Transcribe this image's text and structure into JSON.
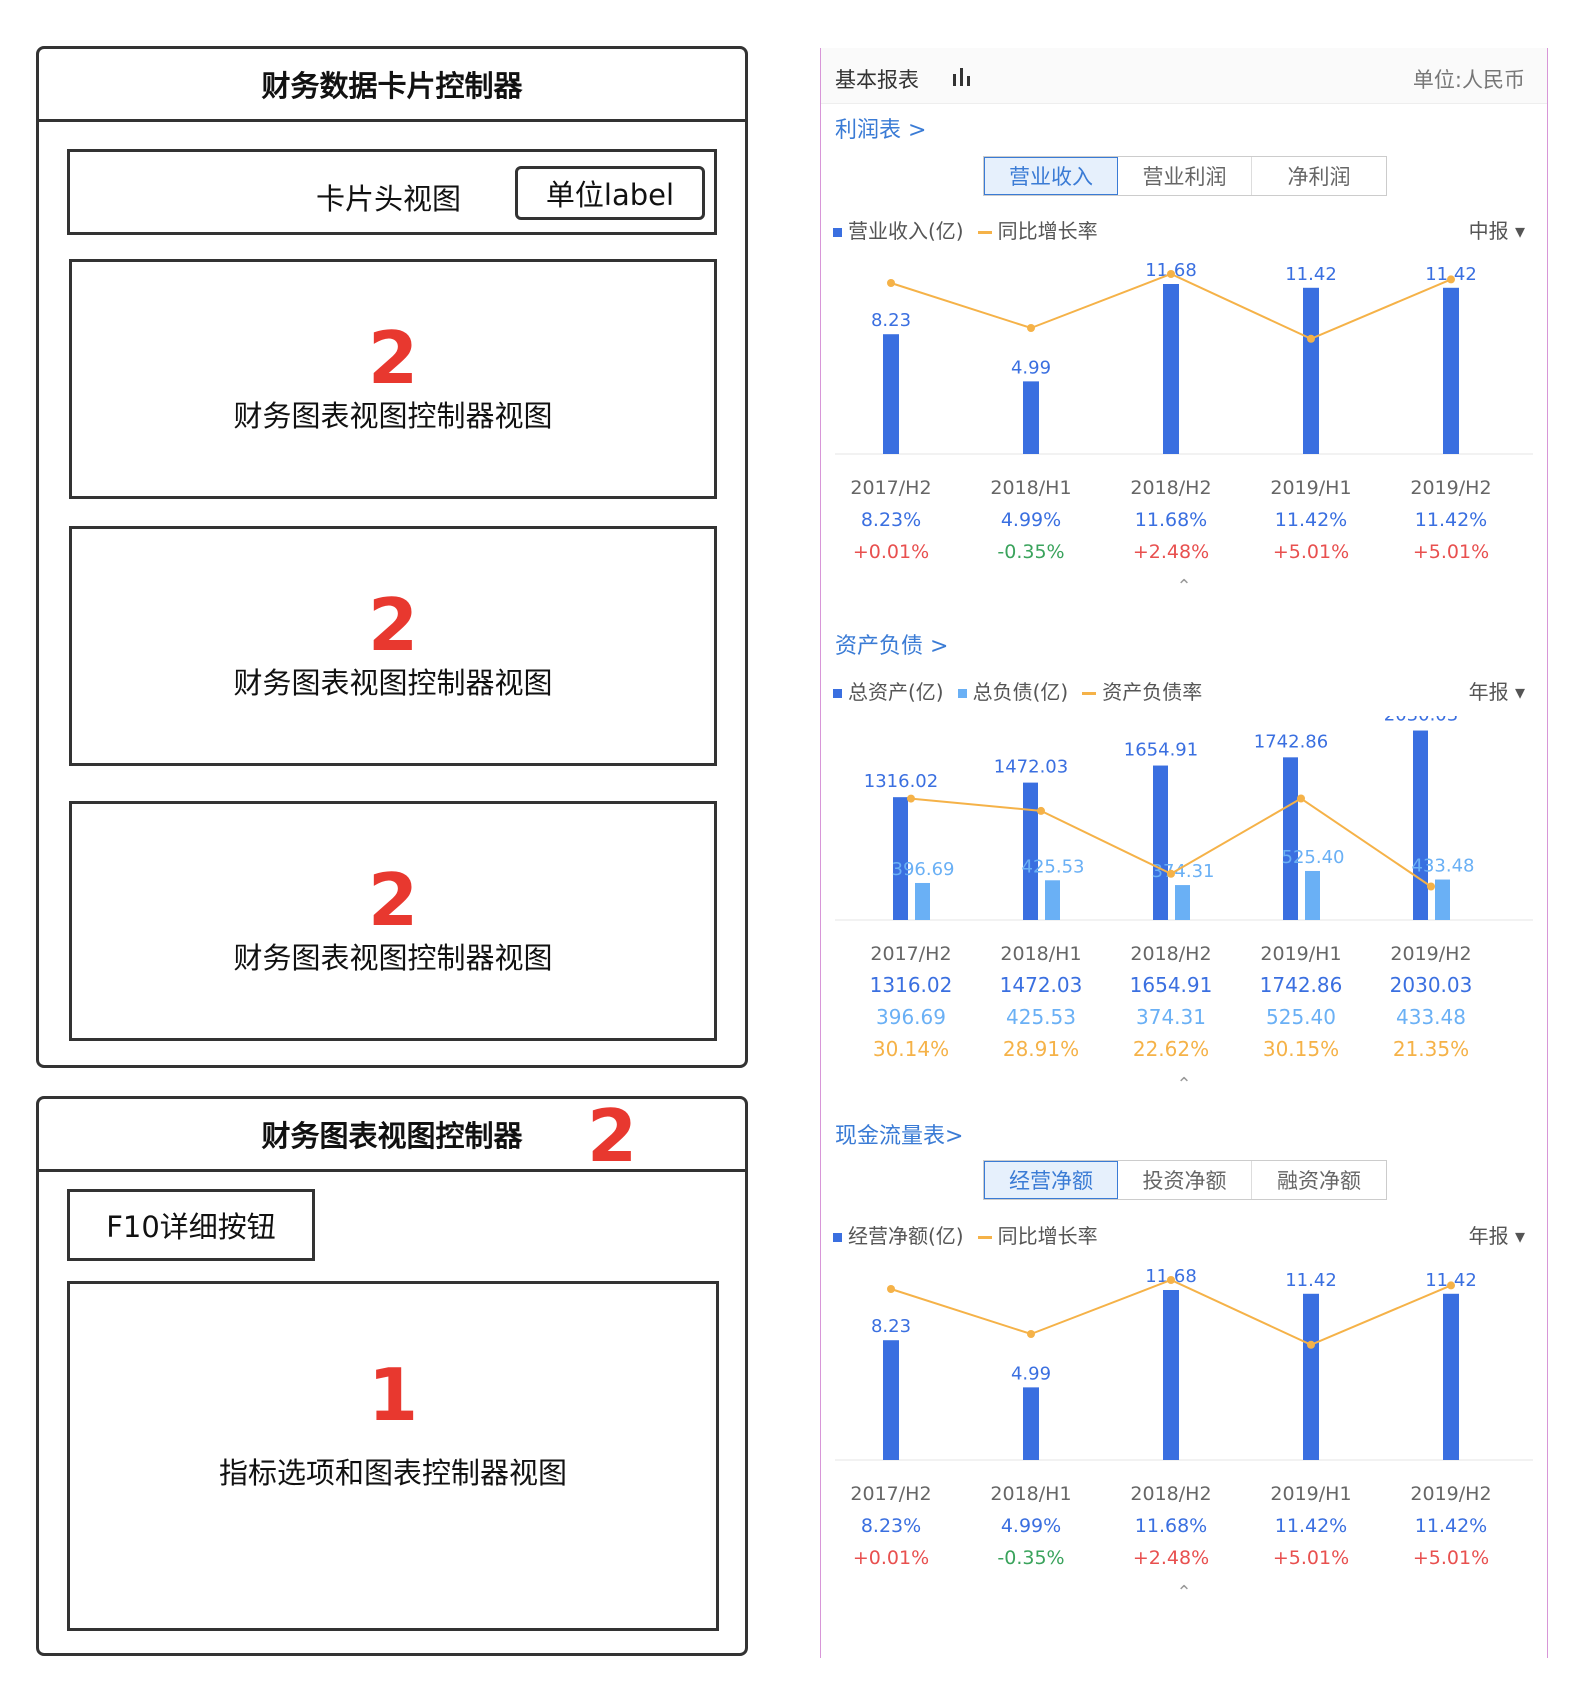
{
  "diagram": {
    "card_controller": {
      "title": "财务数据卡片控制器",
      "header_view": "卡片头视图",
      "unit_label": "单位label",
      "chart_views": [
        {
          "num": "2",
          "label": "财务图表视图控制器视图"
        },
        {
          "num": "2",
          "label": "财务图表视图控制器视图"
        },
        {
          "num": "2",
          "label": "财务图表视图控制器视图"
        }
      ]
    },
    "chart_controller": {
      "title": "财务图表视图控制器",
      "num": "2",
      "f10_button": "F10详细按钮",
      "options_view": {
        "num": "1",
        "label": "指标选项和图表控制器视图"
      }
    }
  },
  "panel": {
    "title": "基本报表",
    "unit": "单位:人民币",
    "profit": {
      "link": "利润表 >",
      "tabs": [
        "营业收入",
        "营业利润",
        "净利润"
      ],
      "legend": [
        "营业收入(亿)",
        "同比增长率"
      ],
      "period": "中报"
    },
    "balance": {
      "link": "资产负债 >",
      "legend": [
        "总资产(亿)",
        "总负债(亿)",
        "资产负债率"
      ],
      "period": "年报"
    },
    "cash": {
      "link": "现金流量表>",
      "tabs": [
        "经营净额",
        "投资净额",
        "融资净额"
      ],
      "legend": [
        "经营净额(亿)",
        "同比增长率"
      ],
      "period": "年报"
    }
  },
  "colors": {
    "bar": "#3a6fe0",
    "bar_light": "#6ab0f5",
    "line": "#f5b248",
    "up": "#e8504f",
    "down": "#3aa35c",
    "link": "#3a7bd5"
  },
  "chart_data": [
    {
      "type": "bar",
      "name": "profit",
      "categories": [
        "2017/H2",
        "2018/H1",
        "2018/H2",
        "2019/H1",
        "2019/H2"
      ],
      "series": [
        {
          "name": "营业收入(亿)",
          "values": [
            8.23,
            4.99,
            11.68,
            11.42,
            11.42
          ]
        }
      ],
      "line_relative": [
        0.95,
        0.7,
        1.0,
        0.64,
        0.97
      ],
      "row1": [
        "8.23%",
        "4.99%",
        "11.68%",
        "11.42%",
        "11.42%"
      ],
      "row2": [
        "+0.01%",
        "-0.35%",
        "+2.48%",
        "+5.01%",
        "+5.01%"
      ]
    },
    {
      "type": "bar",
      "name": "balance",
      "categories": [
        "2017/H2",
        "2018/H1",
        "2018/H2",
        "2019/H1",
        "2019/H2"
      ],
      "series": [
        {
          "name": "总资产(亿)",
          "values": [
            1316.02,
            1472.03,
            1654.91,
            1742.86,
            2030.03
          ]
        },
        {
          "name": "总负债(亿)",
          "values": [
            396.69,
            425.53,
            374.31,
            525.4,
            433.48
          ]
        },
        {
          "name": "资产负债率",
          "values": [
            30.14,
            28.91,
            22.62,
            30.15,
            21.35
          ]
        }
      ],
      "rows": [
        [
          "1316.02",
          "1472.03",
          "1654.91",
          "1742.86",
          "2030.03"
        ],
        [
          "396.69",
          "425.53",
          "374.31",
          "525.40",
          "433.48"
        ],
        [
          "30.14%",
          "28.91%",
          "22.62%",
          "30.15%",
          "21.35%"
        ]
      ]
    },
    {
      "type": "bar",
      "name": "cash",
      "categories": [
        "2017/H2",
        "2018/H1",
        "2018/H2",
        "2019/H1",
        "2019/H2"
      ],
      "series": [
        {
          "name": "经营净额(亿)",
          "values": [
            8.23,
            4.99,
            11.68,
            11.42,
            11.42
          ]
        }
      ],
      "line_relative": [
        0.95,
        0.7,
        1.0,
        0.64,
        0.97
      ],
      "row1": [
        "8.23%",
        "4.99%",
        "11.68%",
        "11.42%",
        "11.42%"
      ],
      "row2": [
        "+0.01%",
        "-0.35%",
        "+2.48%",
        "+5.01%",
        "+5.01%"
      ]
    }
  ]
}
